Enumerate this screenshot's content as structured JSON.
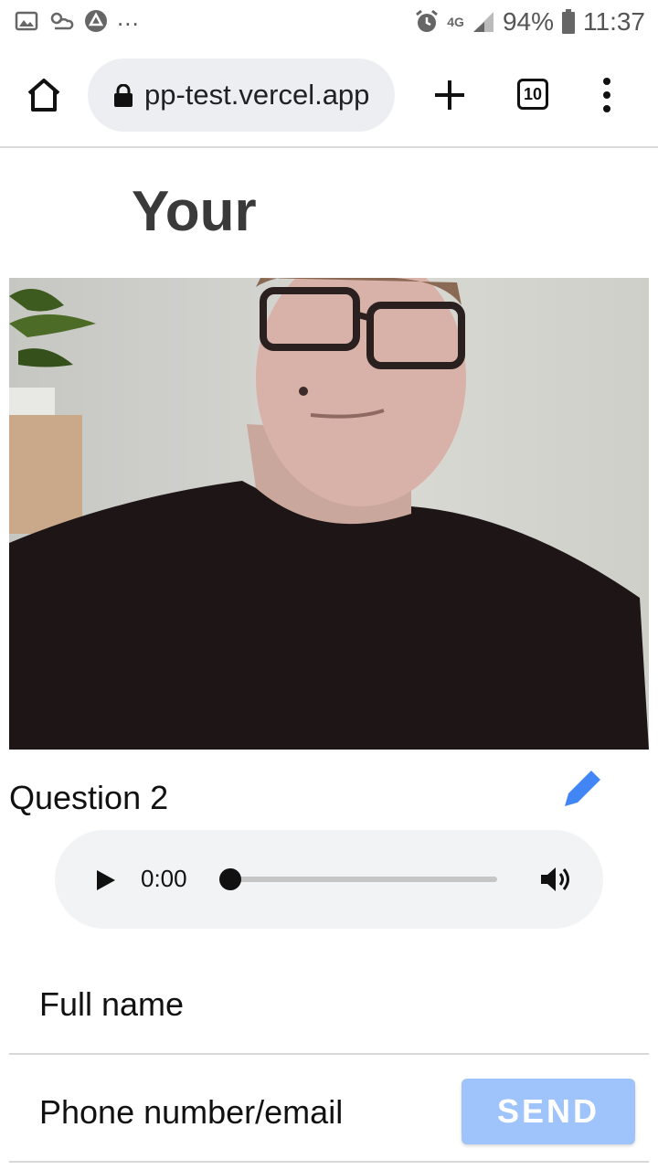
{
  "status_bar": {
    "ellipsis": "...",
    "network": "4G",
    "battery": "94%",
    "time": "11:37"
  },
  "browser": {
    "url": "pp-test.vercel.app",
    "tab_count": "10"
  },
  "page": {
    "heading": "Your",
    "question_label": "Question 2",
    "audio_time": "0:00",
    "audio_progress": 0,
    "name_field_placeholder": "Full name",
    "contact_field_placeholder": "Phone number/email",
    "send_label": "SEND"
  },
  "colors": {
    "accent": "#4285f4",
    "send_bg": "#9fc3fb"
  }
}
